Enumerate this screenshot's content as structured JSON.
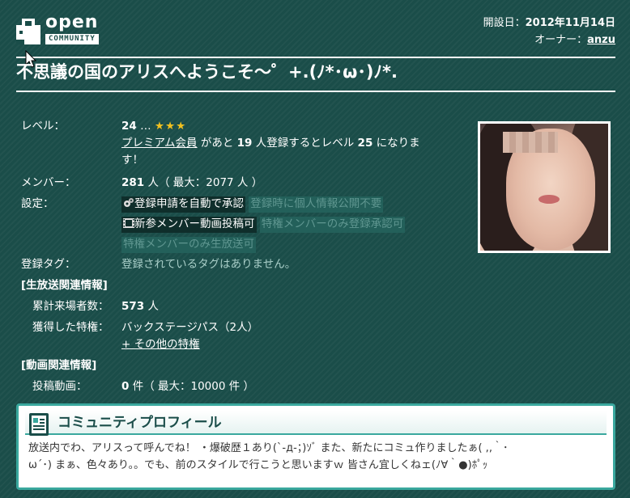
{
  "header": {
    "logo_text_1": "open",
    "logo_text_2": "COMMUNITY",
    "founded_label": "開設日：",
    "founded_value": "2012年11月14日",
    "owner_label": "オーナー：",
    "owner_name": "anzu"
  },
  "title": "不思議の国のアリスへようこそ〜゜+.(ﾉ*･ω･)ﾉ*.",
  "info": {
    "level_label": "レベル：",
    "level_value": "24",
    "level_dots": "…",
    "level_stars": "★★★",
    "premium_link": "プレミアム会員",
    "premium_text_a": " があと ",
    "premium_count": "19",
    "premium_text_b": " 人登録するとレベル ",
    "premium_next": "25",
    "premium_text_c": " になりま",
    "premium_text_d": "す！",
    "members_label": "メンバー：",
    "members_value": "281",
    "members_rest": " 人（ 最大：2077 人 ）",
    "settings_label": "設定：",
    "settings": [
      {
        "label": "登録申請を自動で承認",
        "icon": "gear-icon",
        "enabled": true
      },
      {
        "label": "登録時に個人情報公開不要",
        "enabled": false
      },
      {
        "label": "新参メンバー動画投稿可",
        "icon": "film-icon",
        "enabled": true
      },
      {
        "label": "特権メンバーのみ登録承認可",
        "enabled": false
      },
      {
        "label": "特権メンバーのみ生放送可",
        "enabled": false
      }
    ],
    "tags_label": "登録タグ：",
    "tags_value": "登録されているタグはありません。",
    "live_section": "[生放送関連情報]",
    "visitors_label": "累計来場者数：",
    "visitors_value": "573",
    "visitors_unit": " 人",
    "privileges_label": "獲得した特権：",
    "privileges_value": "バックステージパス（2人）",
    "privileges_more": "+ その他の特権",
    "video_section": "[動画関連情報]",
    "videos_label": "投稿動画：",
    "videos_value": "0",
    "videos_rest": " 件（ 最大：10000 件 ）"
  },
  "profile": {
    "title": "コミュニティプロフィール",
    "text_line1": "放送内でわ、アリスって呼んでね！ ・爆破歴１あり(`-д-；)ｿﾞ また、新たにコミュ作りましたぁ( ,,｀･",
    "text_line2": "ω´･) まぁ、色々あり。。でも、前のスタイルで行こうと思いますｗ 皆さん宜しくねェ(ﾉ∀｀●)ﾎﾟｯ"
  },
  "colors": {
    "background": "#1a4d49",
    "accent": "#3aa89e",
    "star": "#f0c020"
  }
}
